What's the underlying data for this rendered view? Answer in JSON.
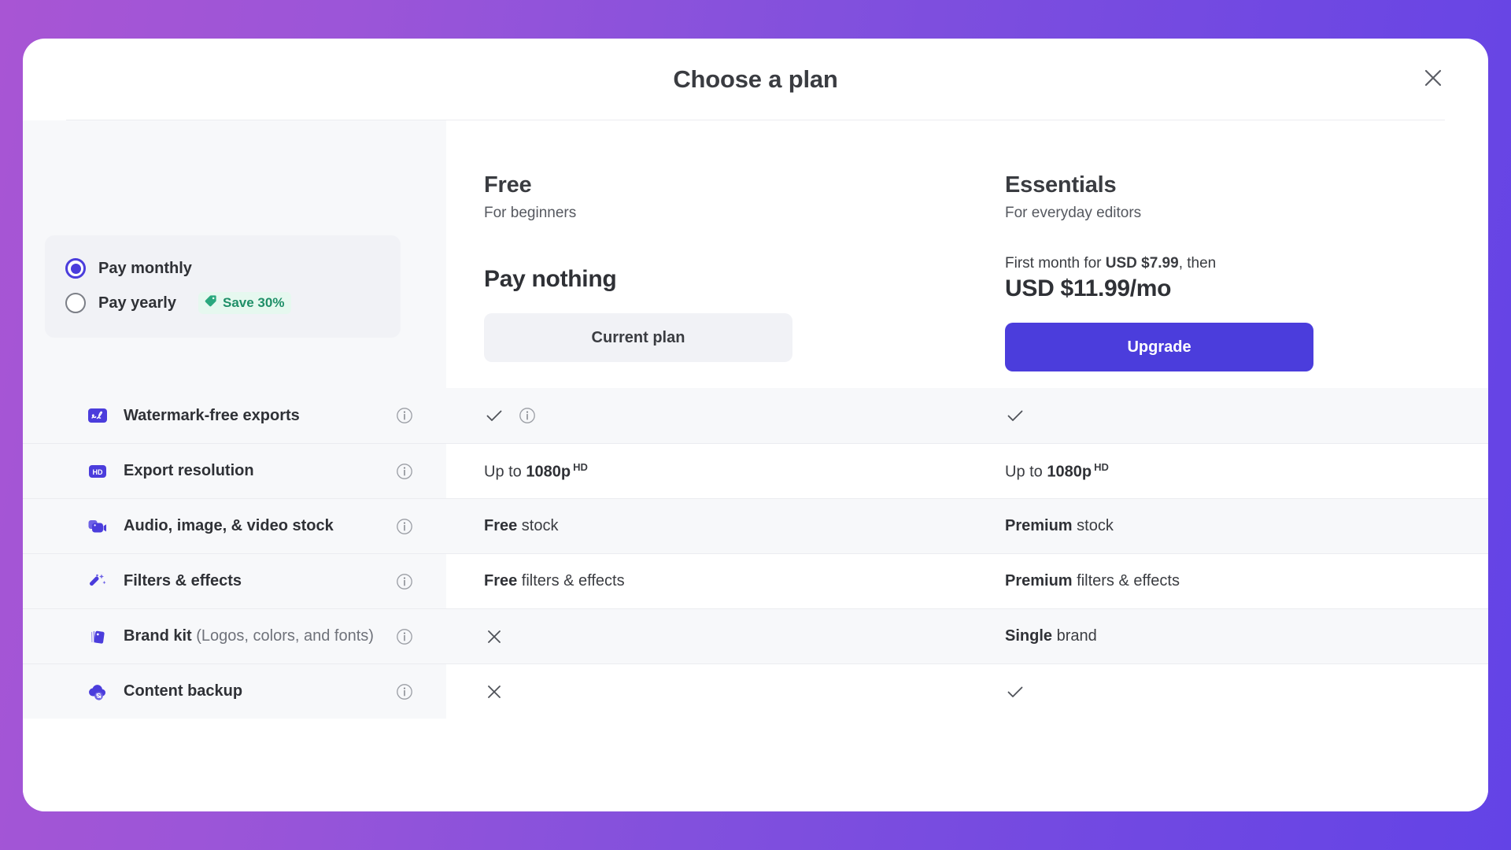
{
  "colors": {
    "accent_purple": "#4b3ddc",
    "icon_purple": "#4b3ddc",
    "save_green": "#1f8f68",
    "save_green_bg": "#e6f8ef",
    "row_stripe": "#f7f8fa",
    "sidebar_bg": "#f7f8fa",
    "text_primary": "#2f3136",
    "text_secondary": "#55585f",
    "bg_gradient_from": "#a855d4",
    "bg_gradient_to": "#6343e6"
  },
  "header": {
    "title": "Choose a plan",
    "close_icon": "close-icon"
  },
  "billing": {
    "options": [
      {
        "label": "Pay monthly",
        "selected": true,
        "badge": null,
        "badge_icon": null
      },
      {
        "label": "Pay yearly",
        "selected": false,
        "badge": "Save 30%",
        "badge_icon": "tag-icon"
      }
    ]
  },
  "plans": [
    {
      "name": "Free",
      "tagline": "For beginners",
      "price_pre": null,
      "price_pre_bold": null,
      "price_pre_tail": null,
      "price": "Pay nothing",
      "cta_label": "Current plan",
      "cta_style": "secondary"
    },
    {
      "name": "Essentials",
      "tagline": "For everyday editors",
      "price_pre": "First month for ",
      "price_pre_bold": "USD $7.99",
      "price_pre_tail": ", then",
      "price": "USD $11.99/mo",
      "cta_label": "Upgrade",
      "cta_style": "primary"
    }
  ],
  "features": [
    {
      "label_bold": "Watermark-free exports",
      "label_muted": null,
      "icon": "watermark-signature-icon",
      "info_icon": "info-icon",
      "free": {
        "kind": "check",
        "text": null,
        "text_bold": null,
        "text_sup": null,
        "info": true
      },
      "essentials": {
        "kind": "check",
        "text": null,
        "text_bold": null,
        "text_sup": null,
        "info": false
      }
    },
    {
      "label_bold": "Export resolution",
      "label_muted": null,
      "icon": "hd-badge-icon",
      "info_icon": "info-icon",
      "free": {
        "kind": "text",
        "text": "Up to ",
        "text_bold": "1080p",
        "text_sup": "HD",
        "info": false
      },
      "essentials": {
        "kind": "text",
        "text": "Up to ",
        "text_bold": "1080p",
        "text_sup": "HD",
        "info": false
      }
    },
    {
      "label_bold": "Audio, image, & video stock",
      "label_muted": null,
      "icon": "video-camera-stock-icon",
      "info_icon": "info-icon",
      "free": {
        "kind": "text",
        "text": null,
        "text_bold": "Free",
        "text_tail": " stock",
        "text_sup": null,
        "info": false
      },
      "essentials": {
        "kind": "text",
        "text": null,
        "text_bold": "Premium",
        "text_tail": " stock",
        "text_sup": null,
        "info": false
      }
    },
    {
      "label_bold": "Filters & effects",
      "label_muted": null,
      "icon": "magic-wand-icon",
      "info_icon": "info-icon",
      "free": {
        "kind": "text",
        "text": null,
        "text_bold": "Free",
        "text_tail": " filters & effects",
        "text_sup": null,
        "info": false
      },
      "essentials": {
        "kind": "text",
        "text": null,
        "text_bold": "Premium",
        "text_tail": " filters & effects",
        "text_sup": null,
        "info": false
      }
    },
    {
      "label_bold": "Brand kit",
      "label_muted": " (Logos, colors, and fonts)",
      "icon": "brand-kit-tag-icon",
      "info_icon": "info-icon",
      "free": {
        "kind": "cross",
        "text": null,
        "text_bold": null,
        "text_sup": null,
        "info": false
      },
      "essentials": {
        "kind": "text",
        "text": null,
        "text_bold": "Single",
        "text_tail": " brand",
        "text_sup": null,
        "info": false
      }
    },
    {
      "label_bold": "Content backup",
      "label_muted": null,
      "icon": "cloud-backup-icon",
      "info_icon": "info-icon",
      "free": {
        "kind": "cross",
        "text": null,
        "text_bold": null,
        "text_sup": null,
        "info": false
      },
      "essentials": {
        "kind": "check",
        "text": null,
        "text_bold": null,
        "text_sup": null,
        "info": false
      }
    }
  ]
}
